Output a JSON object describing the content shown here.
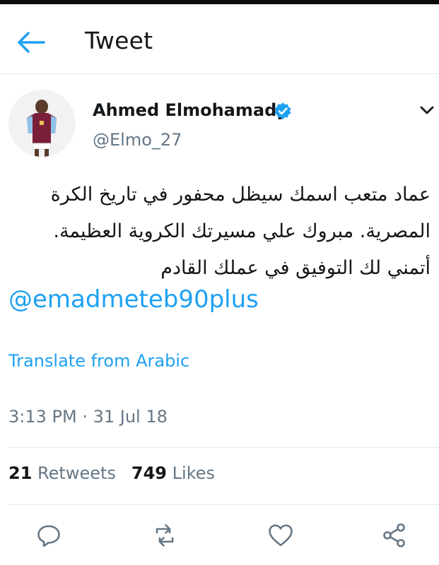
{
  "header": {
    "title": "Tweet",
    "back_icon": "back-arrow-icon"
  },
  "colors": {
    "accent": "#1da1f2",
    "text": "#14171a",
    "muted": "#657786",
    "divider": "#e1e8ed"
  },
  "author": {
    "display_name": "Ahmed Elmohamady",
    "handle": "@Elmo_27",
    "verified_icon": "verified-badge-icon",
    "menu_icon": "chevron-down-icon"
  },
  "tweet": {
    "lines": [
      "عماد متعب اسمك سيظل محفور في تاريخ الكرة",
      "المصرية. مبروك علي مسيرتك الكروية العظيمة.",
      "أتمني لك التوفيق في عملك القادم"
    ],
    "mention": "@emadmeteb90plus",
    "translate_label": "Translate from Arabic",
    "timestamp": "3:13 PM · 31 Jul 18"
  },
  "stats": {
    "retweets_count": "21",
    "retweets_label": "Retweets",
    "likes_count": "749",
    "likes_label": "Likes"
  },
  "actions": [
    {
      "name": "reply",
      "icon": "reply-icon"
    },
    {
      "name": "retweet",
      "icon": "retweet-icon"
    },
    {
      "name": "like",
      "icon": "heart-icon"
    },
    {
      "name": "share",
      "icon": "share-icon"
    }
  ]
}
